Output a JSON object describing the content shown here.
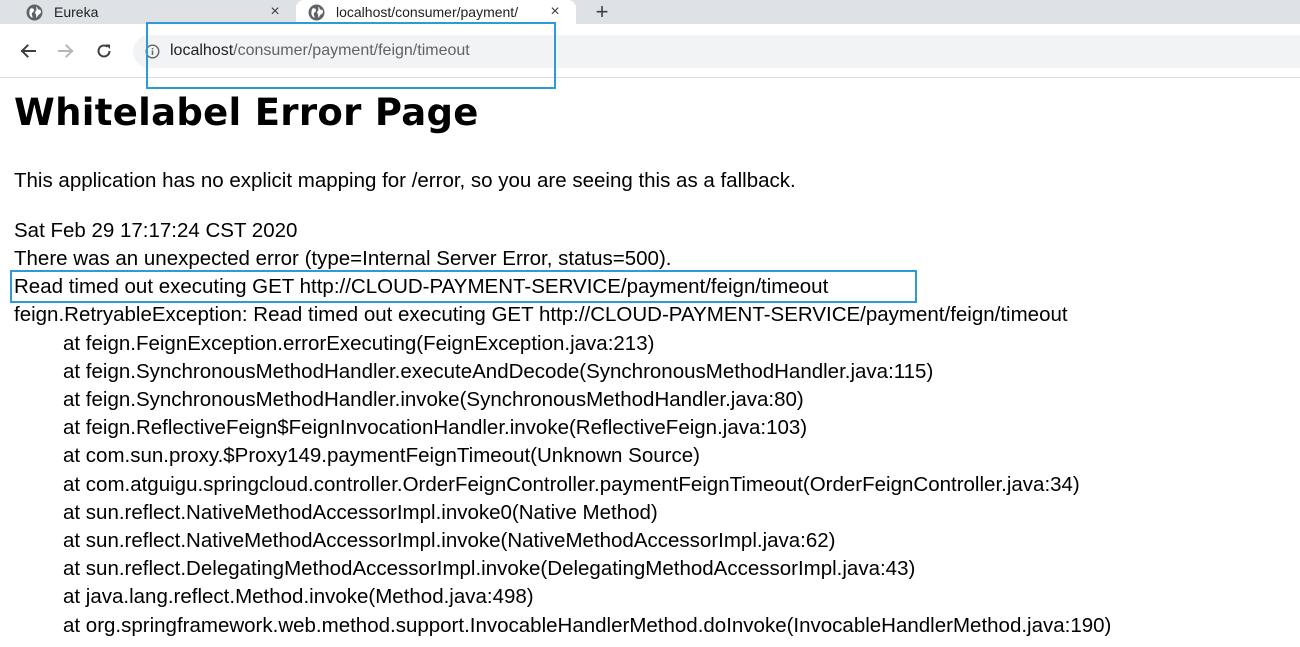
{
  "browser": {
    "tabs": [
      {
        "title": "Eureka",
        "active": false,
        "icon": "globe-icon"
      },
      {
        "title": "localhost/consumer/payment/",
        "active": true,
        "icon": "globe-icon"
      }
    ],
    "new_tab_icon": "+",
    "close_icon": "×",
    "address": {
      "host": "localhost",
      "path": "/consumer/payment/feign/timeout"
    }
  },
  "page": {
    "title": "Whitelabel Error Page",
    "intro": "This application has no explicit mapping for /error, so you are seeing this as a fallback.",
    "timestamp": "Sat Feb 29 17:17:24 CST 2020",
    "error_summary": "There was an unexpected error (type=Internal Server Error, status=500).",
    "message": "Read timed out executing GET http://CLOUD-PAYMENT-SERVICE/payment/feign/timeout",
    "exception": "feign.RetryableException: Read timed out executing GET http://CLOUD-PAYMENT-SERVICE/payment/feign/timeout",
    "stack": [
      "at feign.FeignException.errorExecuting(FeignException.java:213)",
      "at feign.SynchronousMethodHandler.executeAndDecode(SynchronousMethodHandler.java:115)",
      "at feign.SynchronousMethodHandler.invoke(SynchronousMethodHandler.java:80)",
      "at feign.ReflectiveFeign$FeignInvocationHandler.invoke(ReflectiveFeign.java:103)",
      "at com.sun.proxy.$Proxy149.paymentFeignTimeout(Unknown Source)",
      "at com.atguigu.springcloud.controller.OrderFeignController.paymentFeignTimeout(OrderFeignController.java:34)",
      "at sun.reflect.NativeMethodAccessorImpl.invoke0(Native Method)",
      "at sun.reflect.NativeMethodAccessorImpl.invoke(NativeMethodAccessorImpl.java:62)",
      "at sun.reflect.DelegatingMethodAccessorImpl.invoke(DelegatingMethodAccessorImpl.java:43)",
      "at java.lang.reflect.Method.invoke(Method.java:498)",
      "at org.springframework.web.method.support.InvocableHandlerMethod.doInvoke(InvocableHandlerMethod.java:190)"
    ]
  },
  "colors": {
    "annotation": "#2e9bd6",
    "tabstrip": "#dee1e6",
    "omnibox": "#f1f3f4"
  }
}
